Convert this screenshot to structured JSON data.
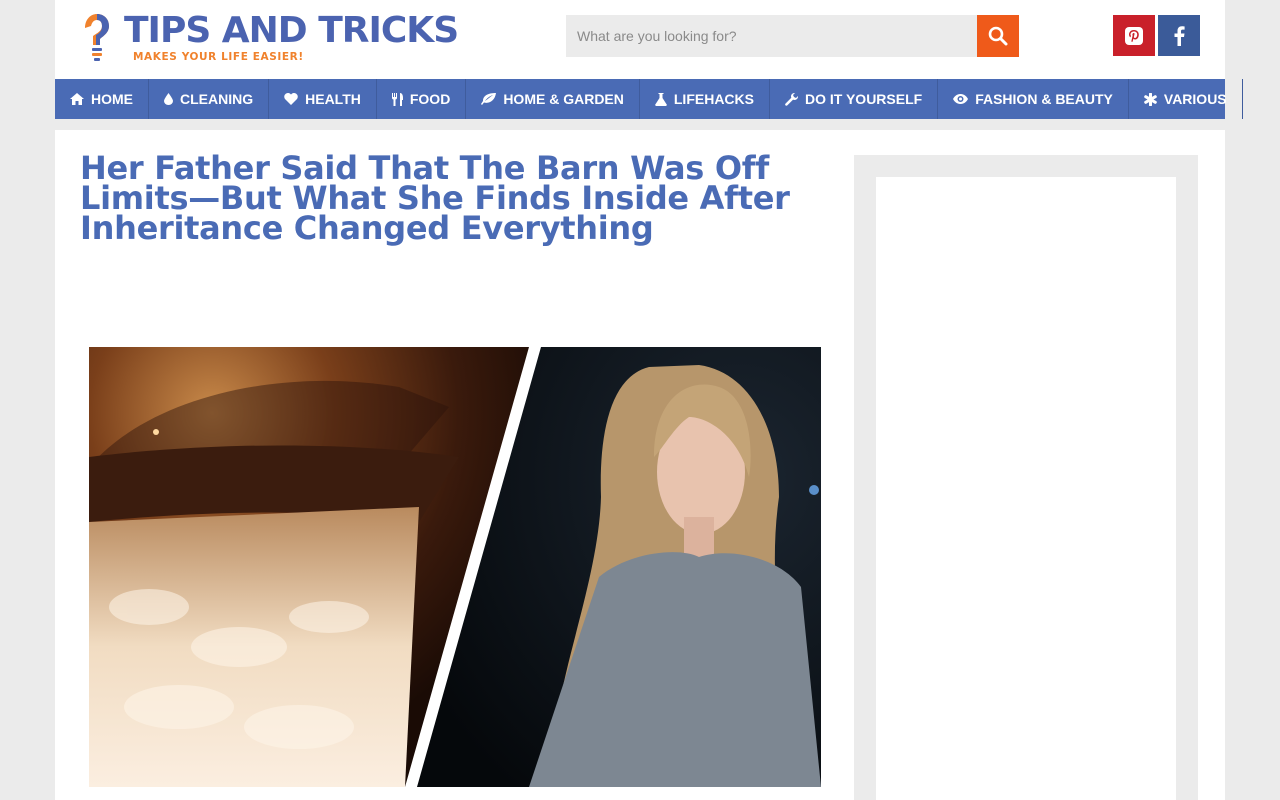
{
  "brand": {
    "title": "TIPS AND TRICKS",
    "tagline": "MAKES YOUR LIFE EASIER!",
    "colors": {
      "primary": "#4b63b0",
      "accent": "#f0822d"
    }
  },
  "search": {
    "placeholder": "What are you looking for?",
    "value": "",
    "button_icon": "search-icon",
    "button_color": "#ef5a1a"
  },
  "social": [
    {
      "name": "pinterest",
      "icon": "pinterest-icon",
      "color": "#c9202a"
    },
    {
      "name": "facebook",
      "icon": "facebook-icon",
      "color": "#3b5b99"
    }
  ],
  "nav": {
    "items": [
      {
        "label": "HOME",
        "icon": "home-icon"
      },
      {
        "label": "CLEANING",
        "icon": "droplet-icon"
      },
      {
        "label": "HEALTH",
        "icon": "heart-icon"
      },
      {
        "label": "FOOD",
        "icon": "cutlery-icon"
      },
      {
        "label": "HOME & GARDEN",
        "icon": "leaf-icon"
      },
      {
        "label": "LIFEHACKS",
        "icon": "flask-icon"
      },
      {
        "label": "DO IT YOURSELF",
        "icon": "wrench-icon"
      },
      {
        "label": "FASHION & BEAUTY",
        "icon": "eye-icon"
      },
      {
        "label": "VARIOUS",
        "icon": "asterisk-icon"
      }
    ],
    "background": "#4a6bb5"
  },
  "article": {
    "title": "Her Father Said That The Barn Was Off Limits—But What She Finds Inside After Inheritance Changed Everything",
    "title_color": "#4a6bb5"
  }
}
